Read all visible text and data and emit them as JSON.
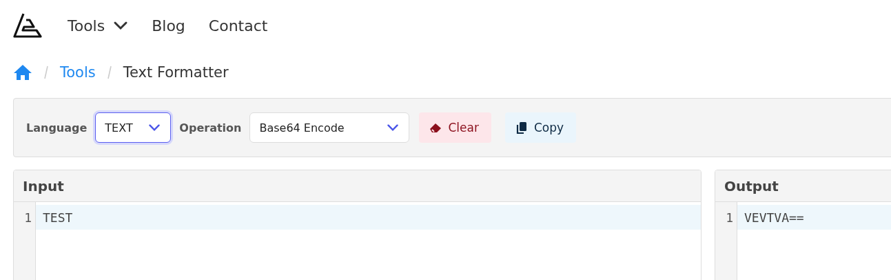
{
  "nav": {
    "items": [
      {
        "label": "Tools",
        "kind": "dropdown"
      },
      {
        "label": "Blog",
        "kind": "link"
      },
      {
        "label": "Contact",
        "kind": "link"
      }
    ]
  },
  "breadcrumb": {
    "links": [
      "Tools"
    ],
    "current": "Text Formatter"
  },
  "toolbar": {
    "selects": [
      {
        "label": "Language",
        "value": "TEXT",
        "focused": true
      },
      {
        "label": "Operation",
        "value": "Base64 Encode",
        "focused": false
      }
    ],
    "buttons": [
      {
        "label": "Clear",
        "kind": "clear"
      },
      {
        "label": "Copy",
        "kind": "copy"
      }
    ]
  },
  "panels": [
    {
      "title": "Input",
      "lines": [
        {
          "number": "1",
          "text": "TEST"
        }
      ]
    },
    {
      "title": "Output",
      "lines": [
        {
          "number": "1",
          "text": "VEVTVA=="
        }
      ]
    }
  ]
}
